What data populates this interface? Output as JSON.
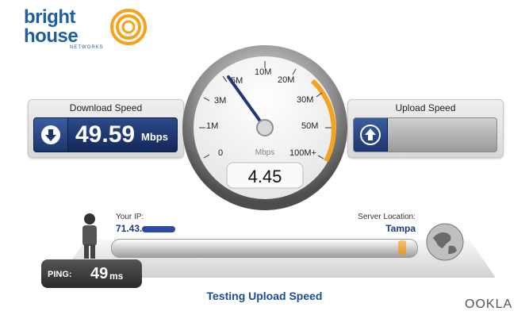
{
  "brand": {
    "line1": "bright",
    "line2": "house",
    "sub": "NETWORKS",
    "colors": {
      "text": "#1f5f9e",
      "rings": "#f7a21b"
    }
  },
  "download": {
    "title": "Download Speed",
    "value": "49.59",
    "unit": "Mbps",
    "icon": "download-arrow-icon"
  },
  "upload": {
    "title": "Upload Speed",
    "value": "",
    "unit": "",
    "icon": "upload-arrow-icon"
  },
  "gauge": {
    "ticks": [
      "0",
      "1M",
      "3M",
      "5M",
      "10M",
      "20M",
      "30M",
      "50M",
      "100M+"
    ],
    "unit": "Mbps",
    "value": "4.45",
    "needle_value": 4.45,
    "arc_color": "#f3a31c"
  },
  "ip": {
    "label": "Your IP:",
    "value": "71.43."
  },
  "server": {
    "label": "Server Location:",
    "value": "Tampa"
  },
  "ping": {
    "label": "PING:",
    "value": "49",
    "unit": "ms"
  },
  "status": "Testing Upload Speed",
  "upload_progress": 0.95,
  "footer": {
    "logo": "OOKLA"
  }
}
